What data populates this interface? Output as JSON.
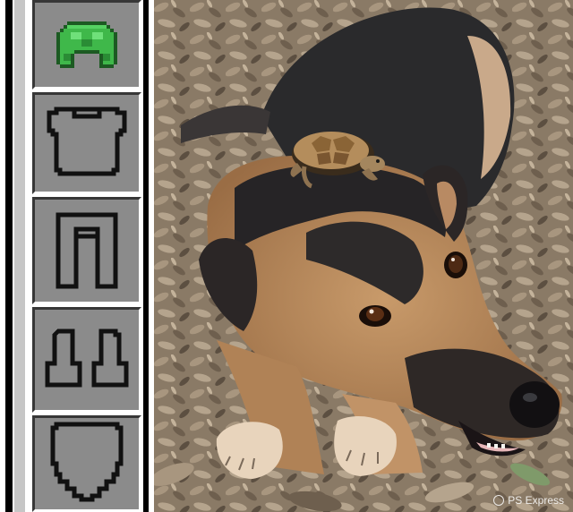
{
  "armor_slots": [
    {
      "name": "helmet-slot",
      "icon": "turtle-shell-helmet-icon",
      "equipped": true,
      "color": "#3fb84a"
    },
    {
      "name": "chestplate-slot",
      "icon": "empty-chestplate-icon",
      "equipped": false
    },
    {
      "name": "leggings-slot",
      "icon": "empty-leggings-icon",
      "equipped": false
    },
    {
      "name": "boots-slot",
      "icon": "empty-boots-icon",
      "equipped": false
    },
    {
      "name": "shield-slot",
      "icon": "empty-shield-icon",
      "equipped": false
    }
  ],
  "photo": {
    "subject": "dog-with-turtle-on-head-photo",
    "watermark": "PS Express"
  },
  "colors": {
    "slot_bg": "#8b8b8b",
    "slot_shadow": "#373737",
    "slot_highlight": "#ffffff",
    "helmet_green": "#3fb84a"
  }
}
